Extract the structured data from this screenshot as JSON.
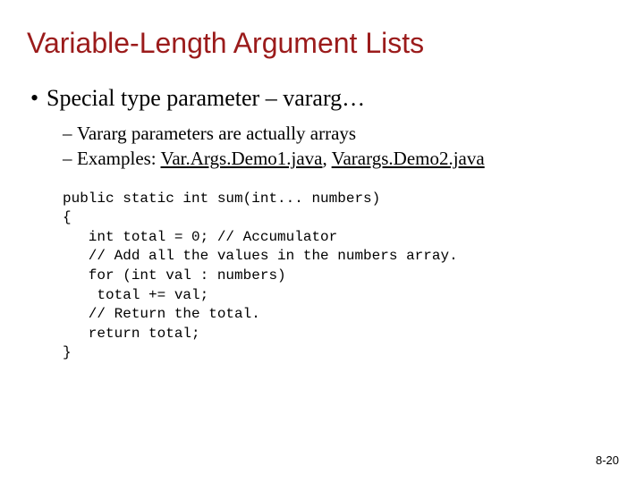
{
  "title": "Variable-Length Argument Lists",
  "bullet1": "Special type parameter – vararg…",
  "sub1": "Vararg parameters are actually arrays",
  "sub2_prefix": "Examples: ",
  "sub2_link1": "Var.Args.Demo1.java",
  "sub2_sep": ", ",
  "sub2_link2": "Varargs.Demo2.java",
  "code": "public static int sum(int... numbers)\n{\n   int total = 0; // Accumulator\n   // Add all the values in the numbers array.\n   for (int val : numbers)\n    total += val;\n   // Return the total.\n   return total;\n}",
  "pagenum": "8-20"
}
